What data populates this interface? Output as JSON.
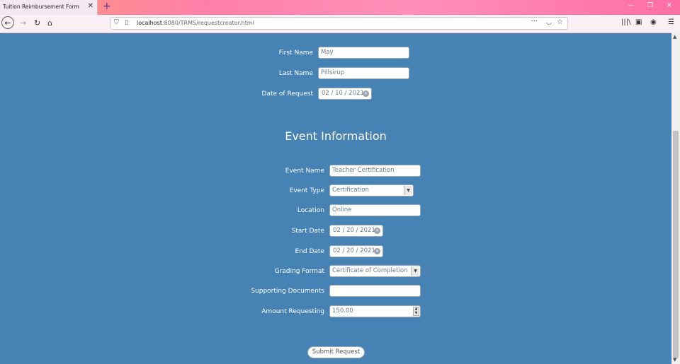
{
  "browser": {
    "tab_title": "Tuition Reimbursement Form",
    "tab_close": "✕",
    "new_tab": "+",
    "url_host": "localhost",
    "url_rest": ":8080/TRMS/requestcreator.html",
    "win_min": "—",
    "win_max": "❐",
    "win_close": "✕"
  },
  "requester": {
    "first_name": {
      "label": "First Name",
      "value": "May"
    },
    "last_name": {
      "label": "Last Name",
      "value": "Pillsirup"
    },
    "date_of_request": {
      "label": "Date of Request",
      "value": "02 / 10 / 2021"
    }
  },
  "event": {
    "section_title": "Event Information",
    "event_name": {
      "label": "Event Name",
      "value": "Teacher Certification"
    },
    "event_type": {
      "label": "Event Type",
      "value": "Certification"
    },
    "location": {
      "label": "Location",
      "value": "Online"
    },
    "start_date": {
      "label": "Start Date",
      "value": "02 / 20 / 2021"
    },
    "end_date": {
      "label": "End Date",
      "value": "02 / 20 / 2021"
    },
    "grading_format": {
      "label": "Grading Format",
      "value": "Certificate of Completion"
    },
    "supporting_documents": {
      "label": "Supporting Documents",
      "value": ""
    },
    "amount_requesting": {
      "label": "Amount Requesting",
      "value": "150.00"
    }
  },
  "submit_label": "Submit Request",
  "icons": {
    "back": "back-arrow-icon",
    "forward": "forward-arrow-icon",
    "reload": "reload-icon",
    "home": "home-icon",
    "shield": "shield-icon",
    "page": "page-icon",
    "more": "more-icon",
    "pocket": "pocket-icon",
    "bookmark": "star-icon",
    "library": "library-icon",
    "sidebar": "sidebar-icon",
    "account": "account-icon",
    "menu": "hamburger-menu-icon"
  },
  "colors": {
    "page_background": "#4682b4",
    "label_text": "#ffffff",
    "input_text": "#6b7a8a"
  }
}
